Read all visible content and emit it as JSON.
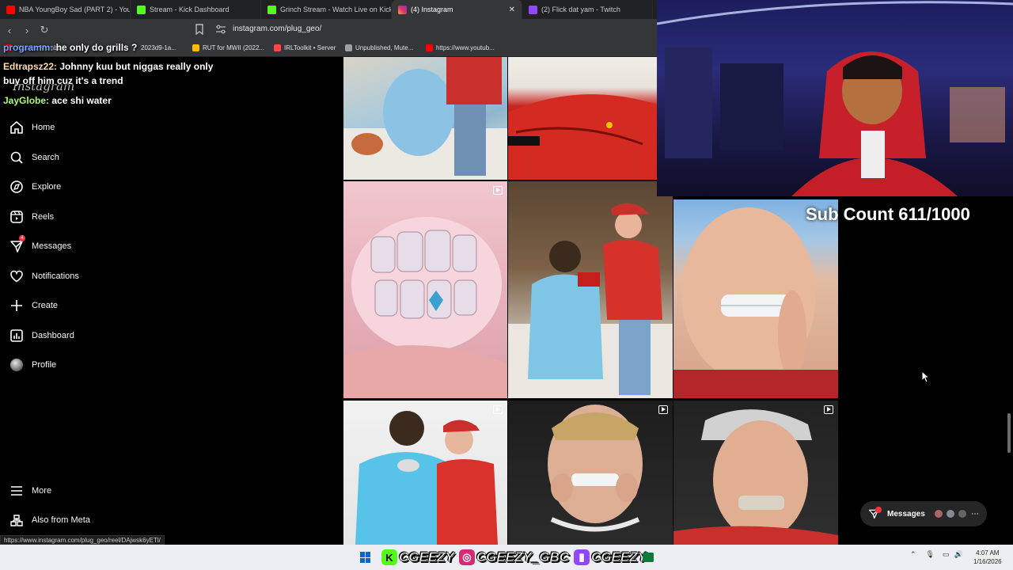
{
  "browser": {
    "tabs": [
      {
        "title": "NBA YoungBoy Sad (PART 2) - YouTube",
        "active": false,
        "color": "#ff0000"
      },
      {
        "title": "Stream - Kick Dashboard",
        "active": false,
        "color": "#53fc18"
      },
      {
        "title": "Grinch Stream - Watch Live on Kick",
        "active": false,
        "color": "#53fc18"
      },
      {
        "title": "(4) Instagram",
        "active": true,
        "color": "#e1306c"
      },
      {
        "title": "(2) Flick dat yam - Twitch",
        "active": false,
        "color": "#9146ff"
      }
    ],
    "url": "instagram.com/plug_geo/",
    "bookmarks": [
      {
        "label": "Youtube Membe...",
        "color": "#ff0000"
      },
      {
        "label": "2023d9-1a...",
        "color": "#5f6368"
      },
      {
        "label": "RUT for MWII (2022...",
        "color": "#fbbc04"
      },
      {
        "label": "IRLToolkit • Server",
        "color": "#ff4444"
      },
      {
        "label": "Unpublished, Mute...",
        "color": "#9aa0a6"
      },
      {
        "label": "https://www.youtub...",
        "color": "#ff0000"
      }
    ],
    "status_url": "https://www.instagram.com/plug_geo/reel/DAjwsk6yETl/"
  },
  "chat": [
    {
      "user": "programm:",
      "message": "he only do grills ?"
    },
    {
      "user": "Edtrapsz22:",
      "message": "Johnny kuu but niggas really only"
    },
    {
      "user": "",
      "message": "buy off him cuz it's a trend"
    },
    {
      "user": "JayGlobe:",
      "message": "ace shi water"
    }
  ],
  "instagram": {
    "logo": "Instagram",
    "nav": [
      {
        "label": "Home",
        "icon": "home-icon"
      },
      {
        "label": "Search",
        "icon": "search-icon"
      },
      {
        "label": "Explore",
        "icon": "compass-icon"
      },
      {
        "label": "Reels",
        "icon": "reels-icon"
      },
      {
        "label": "Messages",
        "icon": "messenger-icon",
        "badge": "4"
      },
      {
        "label": "Notifications",
        "icon": "heart-icon"
      },
      {
        "label": "Create",
        "icon": "plus-icon"
      },
      {
        "label": "Dashboard",
        "icon": "dashboard-icon"
      },
      {
        "label": "Profile",
        "icon": "avatar"
      }
    ],
    "bottom_nav": [
      {
        "label": "More",
        "icon": "menu-icon"
      },
      {
        "label": "Also from Meta",
        "icon": "meta-icon"
      }
    ],
    "messages_pill": {
      "label": "Messages",
      "badge": "4"
    }
  },
  "overlay": {
    "sub_count": "Sub Count 611/1000"
  },
  "taskbar": {
    "socials": [
      {
        "platform": "kick",
        "handle": "CGEEZY",
        "color": "#53fc18"
      },
      {
        "platform": "instagram",
        "handle": "CGEEZY_GBC",
        "color": "#d62976"
      },
      {
        "platform": "twitch",
        "handle": "CGEEZY",
        "color": "#9146ff"
      }
    ],
    "time": "4:07 AM",
    "date": "1/16/2026"
  }
}
